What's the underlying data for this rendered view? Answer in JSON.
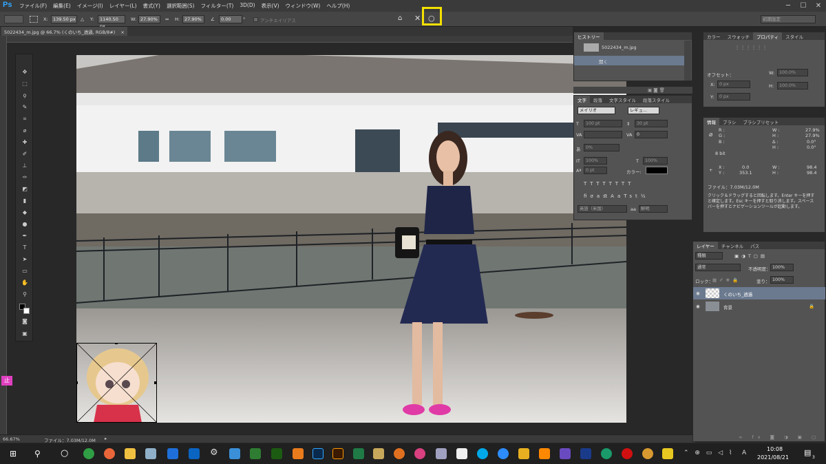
{
  "menubar": {
    "logo": "Ps",
    "items": [
      "ファイル(F)",
      "編集(E)",
      "イメージ(I)",
      "レイヤー(L)",
      "書式(Y)",
      "選択範囲(S)",
      "フィルター(T)",
      "3D(D)",
      "表示(V)",
      "ウィンドウ(W)",
      "ヘルプ(H)"
    ],
    "window_controls": [
      "─",
      "☐",
      "✕"
    ]
  },
  "options": {
    "x_label": "X:",
    "x_value": "139.50 px",
    "y_label": "Y:",
    "y_value": "1140.50 px",
    "w_label": "W:",
    "w_value": "27.90%",
    "h_label": "H:",
    "h_value": "27.90%",
    "angle_value": "0.00",
    "angle_unit": "°",
    "antialias_label": "アンチエイリアス",
    "workspace": "初期設定"
  },
  "document": {
    "tab_title": "5022434_m.jpg @ 66.7% (くのいち_透過, RGB/8#)",
    "tab_close": "×"
  },
  "status": {
    "zoom": "66.67%",
    "file_info": "ファイル：7.03M/12.0M"
  },
  "history_panel": {
    "tab": "ヒストリー",
    "snapshot": "5022434_m.jpg",
    "state": "開く"
  },
  "character_panel": {
    "tabs": [
      "文字",
      "段落",
      "文字スタイル",
      "段落スタイル"
    ],
    "font_family": "メイリオ",
    "font_style": "レギュ...",
    "font_size": "100 pt",
    "leading": "30 pt",
    "kerning": "",
    "tracking": "0",
    "scale_pct": "0%",
    "vscale": "100%",
    "hscale": "100%",
    "baseline": "0 pt",
    "color_label": "カラー:",
    "language": "英語（米国）",
    "aa_label": "aa",
    "aa_mode": "鮮明"
  },
  "color_panel": {
    "tabs": [
      "カラー",
      "スウォッチ",
      "プロパティ",
      "スタイル"
    ],
    "offset_label": "オフセット：",
    "x_label": "X:",
    "x_value": "0 px",
    "y_label": "Y:",
    "y_value": "0 px",
    "w_label": "W:",
    "w_value": "100.0%",
    "h_label": "H:",
    "h_value": "100.0%"
  },
  "info_panel": {
    "tabs": [
      "情報",
      "ブラシ",
      "ブラシプリセット"
    ],
    "r": "R :",
    "g": "G :",
    "b": "B :",
    "bit": "8 bit",
    "w_pct": "27.9%",
    "h_pct": "27.9%",
    "a": "0.0°",
    "h2": "0.0°",
    "x": "0.0",
    "y": "353.1",
    "w": "98.4",
    "h": "98.4",
    "file": "ファイル：7.03M/12.0M",
    "hint": "クリック＆ドラッグすると回転します。Enter キーを押すと確定します。Esc キーを押すと取り消します。スペースバーを押すとナビゲーションツールが起動します。"
  },
  "layers_panel": {
    "tabs": [
      "レイヤー",
      "チャンネル",
      "パス"
    ],
    "filter": "種類",
    "blend_mode": "通常",
    "opacity_label": "不透明度：",
    "opacity": "100%",
    "lock_label": "ロック：",
    "fill_label": "塗り：",
    "fill": "100%",
    "layers": [
      "くのいち_透過",
      "背景"
    ]
  },
  "taskbar": {
    "time": "10:08",
    "date": "2021/08/21",
    "ime": "止",
    "notification": "3",
    "lang": "A"
  }
}
